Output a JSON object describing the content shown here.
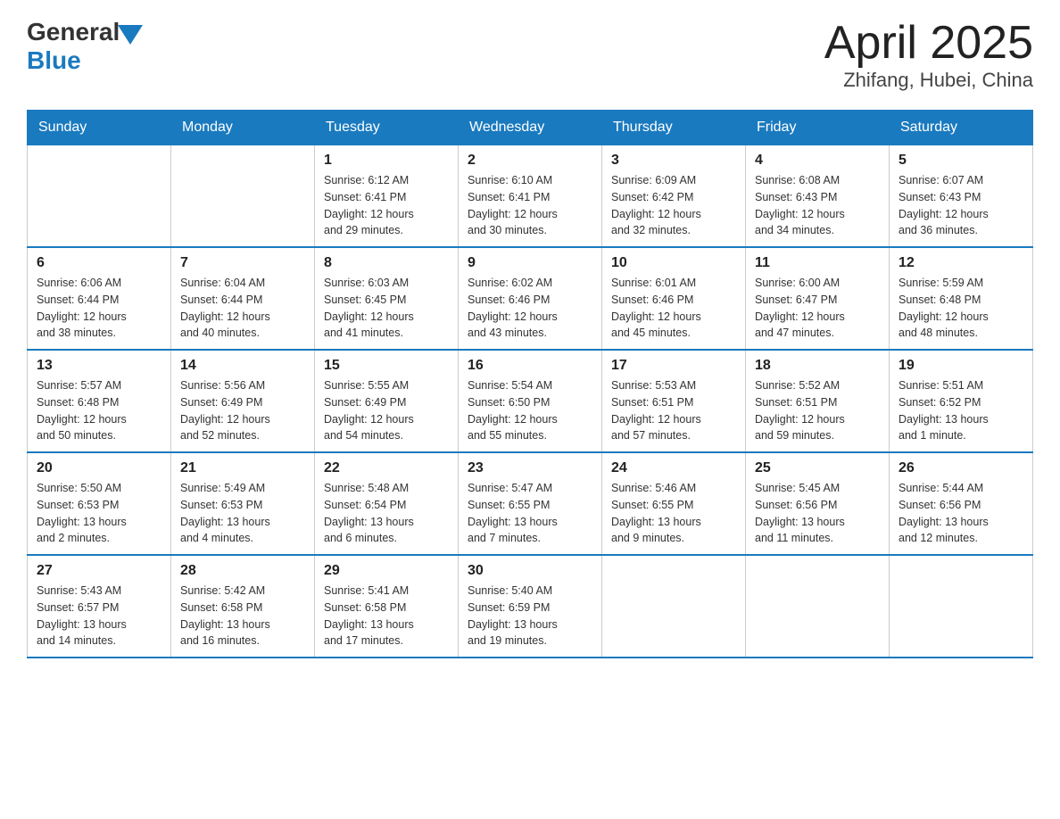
{
  "logo": {
    "general": "General",
    "blue": "Blue"
  },
  "title": "April 2025",
  "subtitle": "Zhifang, Hubei, China",
  "days_header": [
    "Sunday",
    "Monday",
    "Tuesday",
    "Wednesday",
    "Thursday",
    "Friday",
    "Saturday"
  ],
  "weeks": [
    [
      {
        "day": "",
        "info": ""
      },
      {
        "day": "",
        "info": ""
      },
      {
        "day": "1",
        "info": "Sunrise: 6:12 AM\nSunset: 6:41 PM\nDaylight: 12 hours\nand 29 minutes."
      },
      {
        "day": "2",
        "info": "Sunrise: 6:10 AM\nSunset: 6:41 PM\nDaylight: 12 hours\nand 30 minutes."
      },
      {
        "day": "3",
        "info": "Sunrise: 6:09 AM\nSunset: 6:42 PM\nDaylight: 12 hours\nand 32 minutes."
      },
      {
        "day": "4",
        "info": "Sunrise: 6:08 AM\nSunset: 6:43 PM\nDaylight: 12 hours\nand 34 minutes."
      },
      {
        "day": "5",
        "info": "Sunrise: 6:07 AM\nSunset: 6:43 PM\nDaylight: 12 hours\nand 36 minutes."
      }
    ],
    [
      {
        "day": "6",
        "info": "Sunrise: 6:06 AM\nSunset: 6:44 PM\nDaylight: 12 hours\nand 38 minutes."
      },
      {
        "day": "7",
        "info": "Sunrise: 6:04 AM\nSunset: 6:44 PM\nDaylight: 12 hours\nand 40 minutes."
      },
      {
        "day": "8",
        "info": "Sunrise: 6:03 AM\nSunset: 6:45 PM\nDaylight: 12 hours\nand 41 minutes."
      },
      {
        "day": "9",
        "info": "Sunrise: 6:02 AM\nSunset: 6:46 PM\nDaylight: 12 hours\nand 43 minutes."
      },
      {
        "day": "10",
        "info": "Sunrise: 6:01 AM\nSunset: 6:46 PM\nDaylight: 12 hours\nand 45 minutes."
      },
      {
        "day": "11",
        "info": "Sunrise: 6:00 AM\nSunset: 6:47 PM\nDaylight: 12 hours\nand 47 minutes."
      },
      {
        "day": "12",
        "info": "Sunrise: 5:59 AM\nSunset: 6:48 PM\nDaylight: 12 hours\nand 48 minutes."
      }
    ],
    [
      {
        "day": "13",
        "info": "Sunrise: 5:57 AM\nSunset: 6:48 PM\nDaylight: 12 hours\nand 50 minutes."
      },
      {
        "day": "14",
        "info": "Sunrise: 5:56 AM\nSunset: 6:49 PM\nDaylight: 12 hours\nand 52 minutes."
      },
      {
        "day": "15",
        "info": "Sunrise: 5:55 AM\nSunset: 6:49 PM\nDaylight: 12 hours\nand 54 minutes."
      },
      {
        "day": "16",
        "info": "Sunrise: 5:54 AM\nSunset: 6:50 PM\nDaylight: 12 hours\nand 55 minutes."
      },
      {
        "day": "17",
        "info": "Sunrise: 5:53 AM\nSunset: 6:51 PM\nDaylight: 12 hours\nand 57 minutes."
      },
      {
        "day": "18",
        "info": "Sunrise: 5:52 AM\nSunset: 6:51 PM\nDaylight: 12 hours\nand 59 minutes."
      },
      {
        "day": "19",
        "info": "Sunrise: 5:51 AM\nSunset: 6:52 PM\nDaylight: 13 hours\nand 1 minute."
      }
    ],
    [
      {
        "day": "20",
        "info": "Sunrise: 5:50 AM\nSunset: 6:53 PM\nDaylight: 13 hours\nand 2 minutes."
      },
      {
        "day": "21",
        "info": "Sunrise: 5:49 AM\nSunset: 6:53 PM\nDaylight: 13 hours\nand 4 minutes."
      },
      {
        "day": "22",
        "info": "Sunrise: 5:48 AM\nSunset: 6:54 PM\nDaylight: 13 hours\nand 6 minutes."
      },
      {
        "day": "23",
        "info": "Sunrise: 5:47 AM\nSunset: 6:55 PM\nDaylight: 13 hours\nand 7 minutes."
      },
      {
        "day": "24",
        "info": "Sunrise: 5:46 AM\nSunset: 6:55 PM\nDaylight: 13 hours\nand 9 minutes."
      },
      {
        "day": "25",
        "info": "Sunrise: 5:45 AM\nSunset: 6:56 PM\nDaylight: 13 hours\nand 11 minutes."
      },
      {
        "day": "26",
        "info": "Sunrise: 5:44 AM\nSunset: 6:56 PM\nDaylight: 13 hours\nand 12 minutes."
      }
    ],
    [
      {
        "day": "27",
        "info": "Sunrise: 5:43 AM\nSunset: 6:57 PM\nDaylight: 13 hours\nand 14 minutes."
      },
      {
        "day": "28",
        "info": "Sunrise: 5:42 AM\nSunset: 6:58 PM\nDaylight: 13 hours\nand 16 minutes."
      },
      {
        "day": "29",
        "info": "Sunrise: 5:41 AM\nSunset: 6:58 PM\nDaylight: 13 hours\nand 17 minutes."
      },
      {
        "day": "30",
        "info": "Sunrise: 5:40 AM\nSunset: 6:59 PM\nDaylight: 13 hours\nand 19 minutes."
      },
      {
        "day": "",
        "info": ""
      },
      {
        "day": "",
        "info": ""
      },
      {
        "day": "",
        "info": ""
      }
    ]
  ]
}
